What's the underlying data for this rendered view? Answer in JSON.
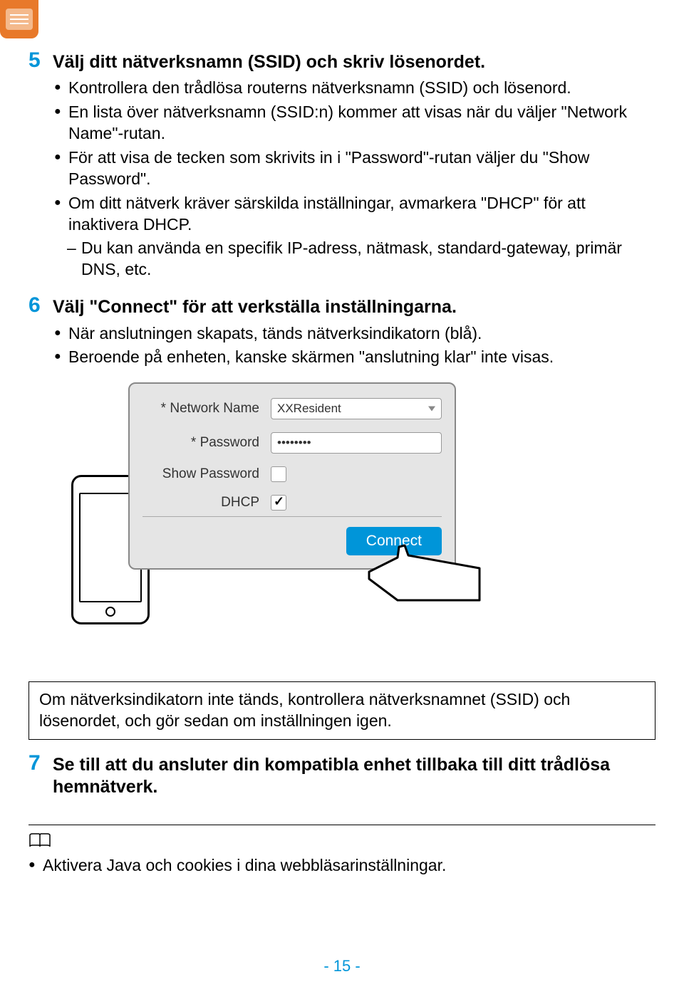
{
  "step5": {
    "num": "5",
    "title": "Välj ditt nätverksnamn (SSID) och skriv lösenordet.",
    "bullets": [
      "Kontrollera den trådlösa routerns nätverksnamn (SSID) och lösenord.",
      "En lista över nätverksnamn (SSID:n) kommer att visas när du väljer \"Network Name\"-rutan.",
      "För att visa de tecken som skrivits in i \"Password\"-rutan väljer du \"Show Password\".",
      "Om ditt nätverk kräver särskilda inställningar, avmarkera \"DHCP\" för att inaktivera DHCP."
    ],
    "sub": "Du kan använda en specifik IP-adress, nätmask, standard-gateway, primär DNS, etc."
  },
  "step6": {
    "num": "6",
    "title": "Välj \"Connect\" för att verkställa inställningarna.",
    "bullets": [
      "När anslutningen skapats, tänds nätverksindikatorn (blå).",
      "Beroende på enheten, kanske skärmen \"anslutning klar\" inte visas."
    ]
  },
  "form": {
    "network_label": "* Network Name",
    "network_value": "XXResident",
    "password_label": "* Password",
    "password_value": "••••••••",
    "show_password_label": "Show Password",
    "dhcp_label": "DHCP",
    "connect_label": "Connect"
  },
  "note_box": "Om nätverksindikatorn inte tänds, kontrollera nätverksnamnet (SSID) och lösenordet, och gör sedan om inställningen igen.",
  "step7": {
    "num": "7",
    "title": "Se till att du ansluter din kompatibla enhet tillbaka till ditt trådlösa hemnätverk."
  },
  "tip": "Aktivera Java och cookies i dina webbläsarinställningar.",
  "page_num": "- 15 -"
}
